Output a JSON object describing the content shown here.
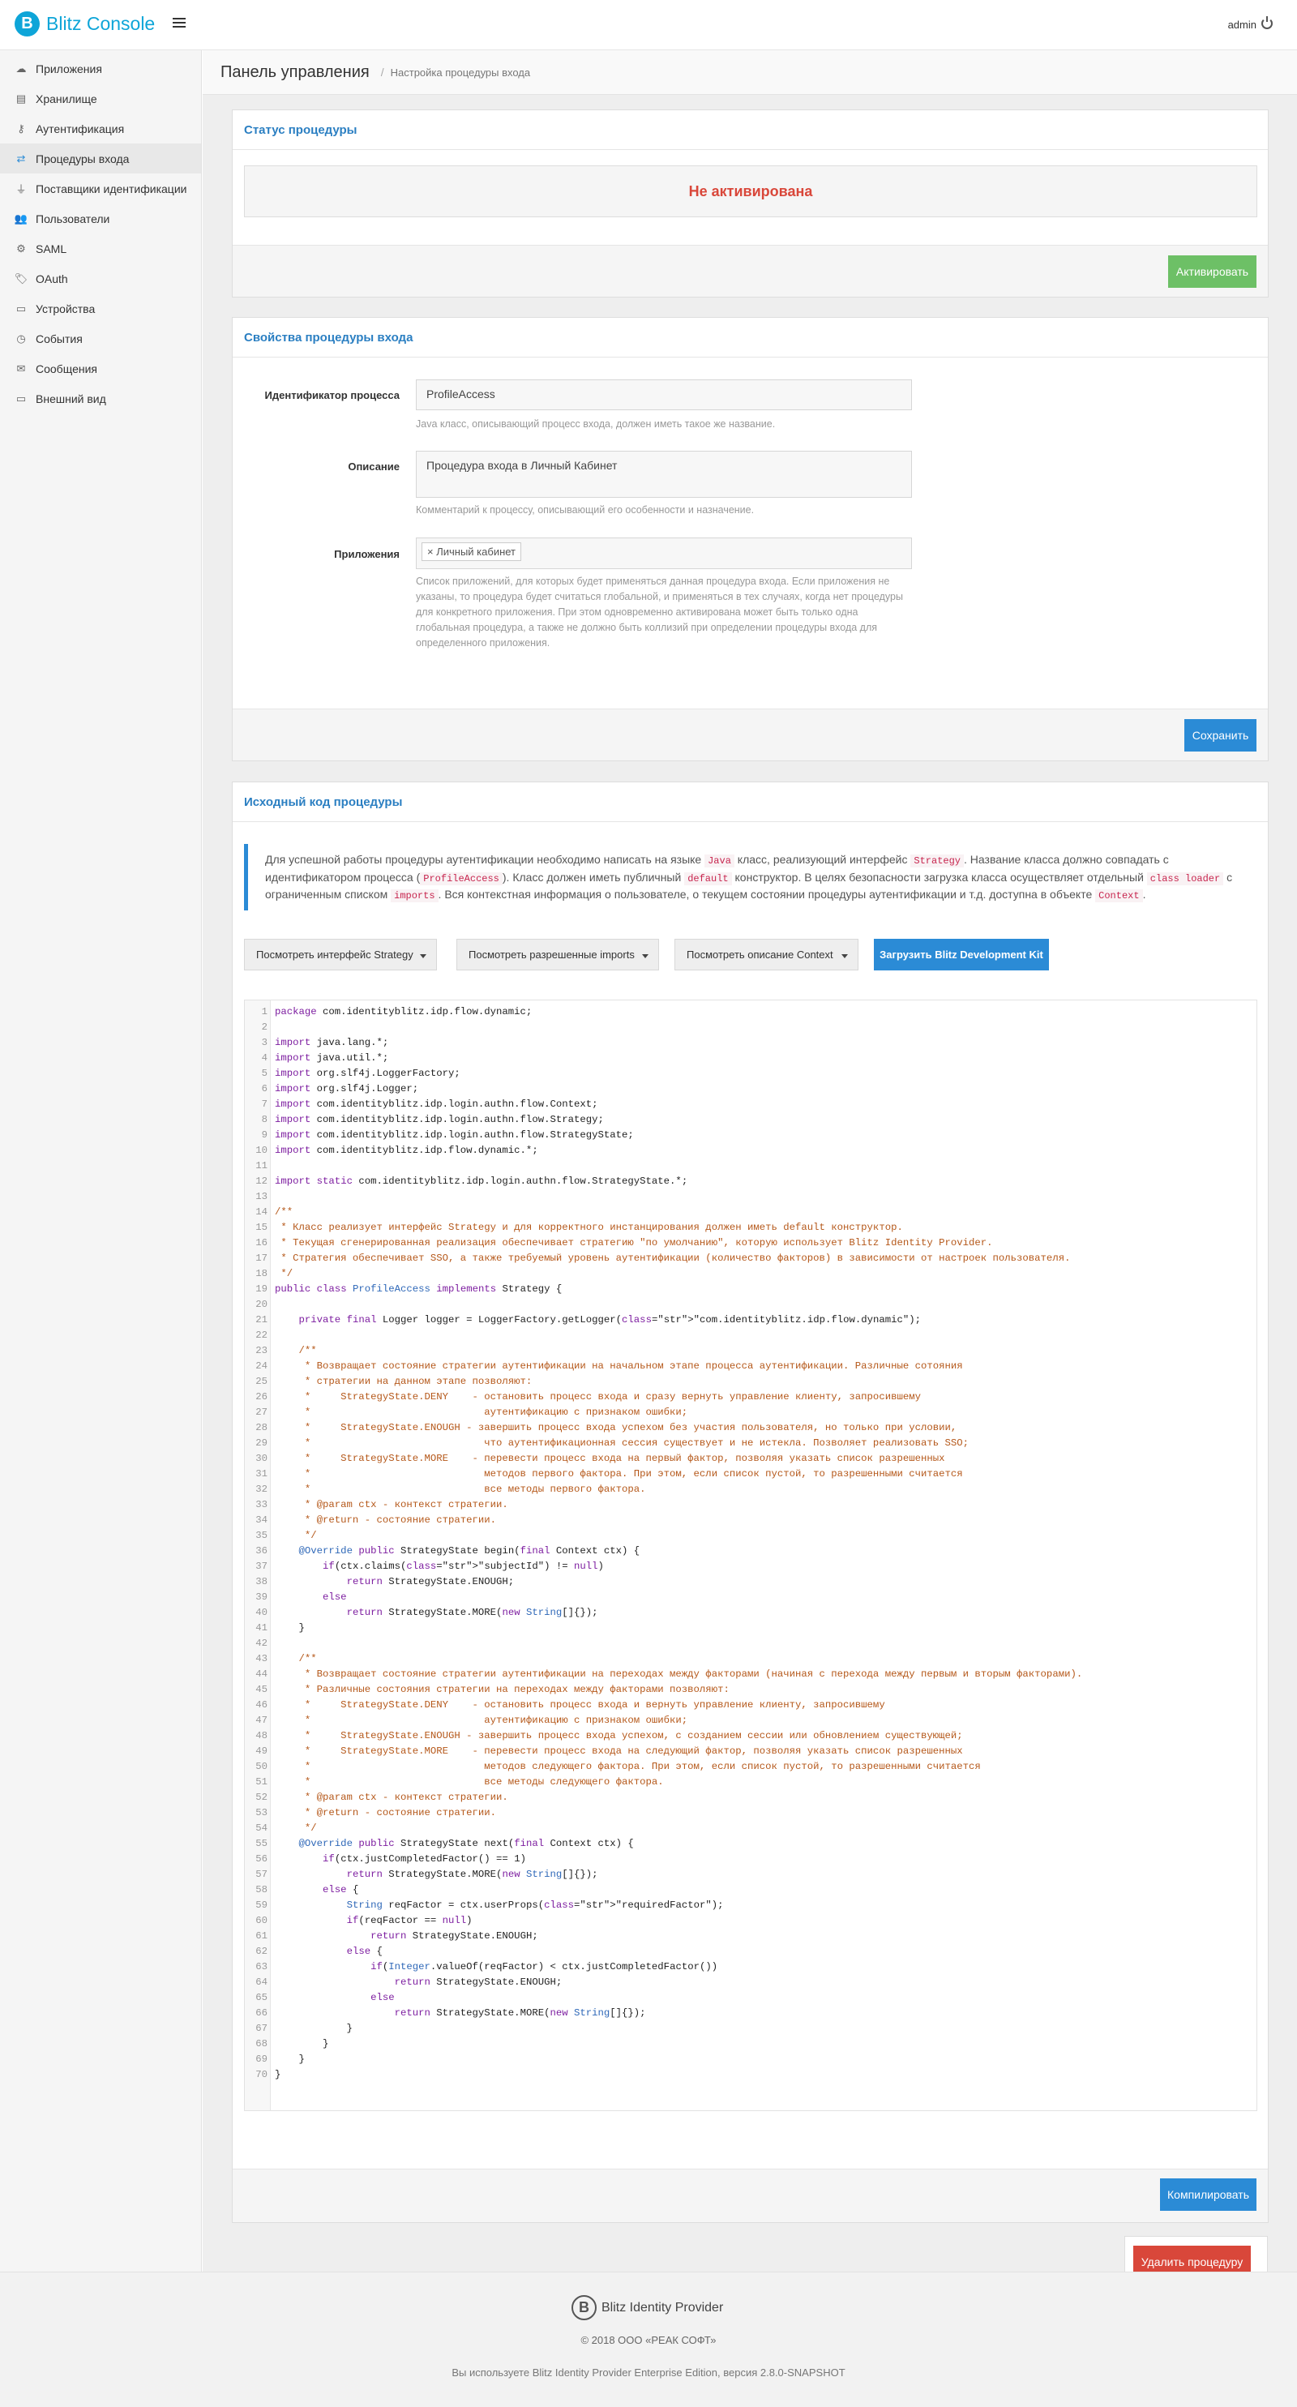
{
  "header": {
    "logo_letter": "B",
    "app_name": "Blitz Console",
    "user": "admin"
  },
  "sidebar": {
    "items": [
      {
        "icon": "cloud-icon",
        "label": "Приложения",
        "active": false
      },
      {
        "icon": "database-icon",
        "label": "Хранилище",
        "active": false
      },
      {
        "icon": "key-icon",
        "label": "Аутентификация",
        "active": false
      },
      {
        "icon": "login-procedure-icon",
        "label": "Процедуры входа",
        "active": true
      },
      {
        "icon": "plug-icon",
        "label": "Поставщики идентификации",
        "active": false
      },
      {
        "icon": "users-icon",
        "label": "Пользователи",
        "active": false
      },
      {
        "icon": "gear-icon",
        "label": "SAML",
        "active": false
      },
      {
        "icon": "tag-icon",
        "label": "OAuth",
        "active": false
      },
      {
        "icon": "devices-icon",
        "label": "Устройства",
        "active": false
      },
      {
        "icon": "clock-icon",
        "label": "События",
        "active": false
      },
      {
        "icon": "envelope-icon",
        "label": "Сообщения",
        "active": false
      },
      {
        "icon": "monitor-icon",
        "label": "Внешний вид",
        "active": false
      }
    ]
  },
  "breadcrumb": {
    "title": "Панель управления",
    "sub": "Настройка процедуры входа"
  },
  "status_panel": {
    "title": "Статус процедуры",
    "status": "Не активирована",
    "activate_button": "Активировать"
  },
  "props_panel": {
    "title": "Свойства процедуры входа",
    "id_label": "Идентификатор процесса",
    "id_value": "ProfileAccess",
    "id_help": "Java класс, описывающий процесс входа, должен иметь такое же название.",
    "desc_label": "Описание",
    "desc_value": "Процедура входа в Личный Кабинет",
    "desc_help": "Комментарий к процессу, описывающий его особенности и назначение.",
    "apps_label": "Приложения",
    "apps_tag": "× Личный кабинет",
    "apps_help": "Список приложений, для которых будет применяться данная процедура входа. Если приложения не указаны, то процедура будет считаться глобальной, и применяться в тех случаях, когда нет процедуры для конкретного приложения. При этом одновременно активирована может быть только одна глобальная процедура, а также не должно быть коллизий при определении процедуры входа для определенного приложения.",
    "save_button": "Сохранить"
  },
  "code_panel": {
    "title": "Исходный код процедуры",
    "callout": {
      "t1": "Для успешной работы процедуры аутентификации необходимо написать на языке ",
      "c1": "Java",
      "t2": " класс, реализующий интерфейс ",
      "c2": "Strategy",
      "t3": ". Название класса должно совпадать с идентификатором процесса (",
      "c3": "ProfileAccess",
      "t4": "). Класс должен иметь публичный ",
      "c4": "default",
      "t5": " конструктор. В целях безопасности загрузка класса осуществляет отдельный ",
      "c5": "class loader",
      "t6": " с ограниченным списком ",
      "c6": "imports",
      "t7": ". Вся контекстная информация о пользователе, о текущем состоянии процедуры аутентификации и т.д. доступна в объекте ",
      "c7": "Context",
      "t8": "."
    },
    "btn_strategy": "Посмотреть интерфейс Strategy",
    "btn_imports": "Посмотреть разрешенные imports",
    "btn_context": "Посмотреть описание Context",
    "btn_devkit": "Загрузить Blitz Development Kit",
    "compile_button": "Компилировать",
    "code_lines": [
      "package com.identityblitz.idp.flow.dynamic;",
      "",
      "import java.lang.*;",
      "import java.util.*;",
      "import org.slf4j.LoggerFactory;",
      "import org.slf4j.Logger;",
      "import com.identityblitz.idp.login.authn.flow.Context;",
      "import com.identityblitz.idp.login.authn.flow.Strategy;",
      "import com.identityblitz.idp.login.authn.flow.StrategyState;",
      "import com.identityblitz.idp.flow.dynamic.*;",
      "",
      "import static com.identityblitz.idp.login.authn.flow.StrategyState.*;",
      "",
      "/**",
      " * Класс реализует интерфейс Strategy и для корректного инстанцирования должен иметь default конструктор.",
      " * Текущая сгенерированная реализация обеспечивает стратегию \"по умолчанию\", которую использует Blitz Identity Provider.",
      " * Стратегия обеспечивает SSO, а также требуемый уровень аутентификации (количество факторов) в зависимости от настроек пользователя.",
      " */",
      "public class ProfileAccess implements Strategy {",
      "",
      "    private final Logger logger = LoggerFactory.getLogger(\"com.identityblitz.idp.flow.dynamic\");",
      "",
      "    /**",
      "     * Возвращает состояние стратегии аутентификации на начальном этапе процесса аутентификации. Различные сотояния",
      "     * стратегии на данном этапе позволяют:",
      "     *     StrategyState.DENY    - остановить процесс входа и сразу вернуть управление клиенту, запросившему",
      "     *                             аутентификацию с признаком ошибки;",
      "     *     StrategyState.ENOUGH - завершить процесс входа успехом без участия пользователя, но только при условии,",
      "     *                             что аутентификационная сессия существует и не истекла. Позволяет реализовать SSO;",
      "     *     StrategyState.MORE    - перевести процесс входа на первый фактор, позволяя указать список разрешенных",
      "     *                             методов первого фактора. При этом, если список пустой, то разрешенными считается",
      "     *                             все методы первого фактора.",
      "     * @param ctx - контекст стратегии.",
      "     * @return - состояние стратегии.",
      "     */",
      "    @Override public StrategyState begin(final Context ctx) {",
      "        if(ctx.claims(\"subjectId\") != null)",
      "            return StrategyState.ENOUGH;",
      "        else",
      "            return StrategyState.MORE(new String[]{});",
      "    }",
      "",
      "    /**",
      "     * Возвращает состояние стратегии аутентификации на переходах между факторами (начиная с перехода между первым и вторым факторами).",
      "     * Различные состояния стратегии на переходах между факторами позволяют:",
      "     *     StrategyState.DENY    - остановить процесс входа и вернуть управление клиенту, запросившему",
      "     *                             аутентификацию с признаком ошибки;",
      "     *     StrategyState.ENOUGH - завершить процесс входа успехом, с созданием сессии или обновлением существующей;",
      "     *     StrategyState.MORE    - перевести процесс входа на следующий фактор, позволяя указать список разрешенных",
      "     *                             методов следующего фактора. При этом, если список пустой, то разрешенными считается",
      "     *                             все методы следующего фактора.",
      "     * @param ctx - контекст стратегии.",
      "     * @return - состояние стратегии.",
      "     */",
      "    @Override public StrategyState next(final Context ctx) {",
      "        if(ctx.justCompletedFactor() == 1)",
      "            return StrategyState.MORE(new String[]{});",
      "        else {",
      "            String reqFactor = ctx.userProps(\"requiredFactor\");",
      "            if(reqFactor == null)",
      "                return StrategyState.ENOUGH;",
      "            else {",
      "                if(Integer.valueOf(reqFactor) < ctx.justCompletedFactor())",
      "                    return StrategyState.ENOUGH;",
      "                else",
      "                    return StrategyState.MORE(new String[]{});",
      "            }",
      "        }",
      "    }",
      "}"
    ]
  },
  "delete_button": "Удалить процедуру",
  "footer": {
    "logo_letter": "B",
    "product": "Blitz Identity Provider",
    "copyright": "© 2018 ООО «РЕАК СОФТ»",
    "version": "Вы используете Blitz Identity Provider Enterprise Edition, версия 2.8.0-SNAPSHOT"
  },
  "colors": {
    "brand": "#0ea5d8",
    "link": "#2b7fc2",
    "primary": "#2b8bd6",
    "success": "#6dc066",
    "danger": "#d9473a"
  }
}
